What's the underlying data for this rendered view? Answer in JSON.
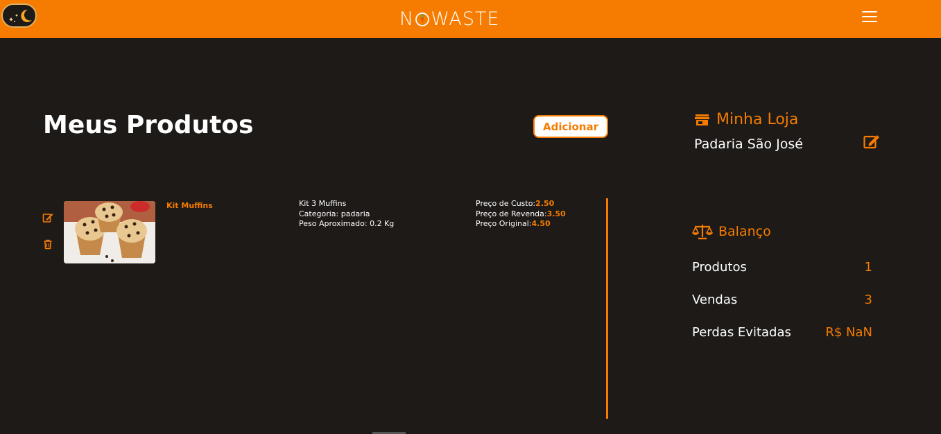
{
  "header": {
    "brand_prefix": "N",
    "brand_suffix": "WASTE",
    "colors": {
      "accent": "#f57c00",
      "background": "#1e1a18",
      "text": "#ffffff"
    }
  },
  "main": {
    "title": "Meus Produtos",
    "add_label": "Adicionar",
    "products": [
      {
        "name": "Kit Muffins",
        "description": "Kit 3 Muffins",
        "category": "Categoria: padaria",
        "weight": "Peso Aproximado: 0.2 Kg",
        "cost_label": "Preço de Custo:",
        "cost_value": "2.50",
        "resale_label": "Preço de Revenda:",
        "resale_value": "3.50",
        "original_label": "Preço Original:",
        "original_value": "4.50"
      }
    ]
  },
  "store": {
    "title": "Minha Loja",
    "name": "Padaria São José"
  },
  "balance": {
    "title": "Balanço",
    "rows": [
      {
        "label": "Produtos",
        "value": "1"
      },
      {
        "label": "Vendas",
        "value": "3"
      },
      {
        "label": "Perdas Evitadas",
        "value": "R$ NaN"
      }
    ]
  },
  "icons": [
    "moon-stars-icon",
    "menu-icon",
    "edit-icon",
    "trash-icon",
    "store-icon",
    "scale-icon"
  ]
}
